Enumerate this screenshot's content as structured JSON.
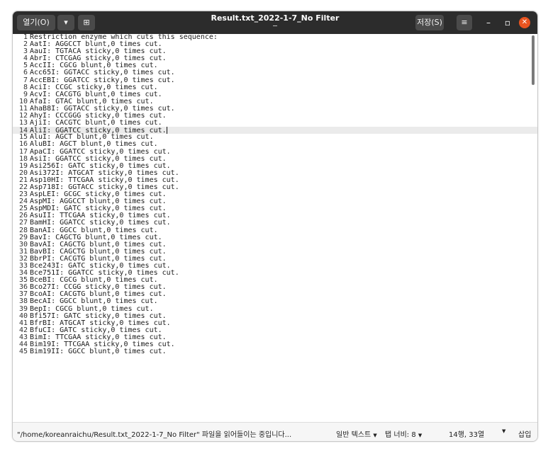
{
  "titlebar": {
    "open_label": "열기(O)",
    "title": "Result.txt_2022-1-7_No Filter",
    "save_label": "저장(S)"
  },
  "editor": {
    "current_line": 14,
    "lines": [
      "Restriction enzyme which cuts this sequence:",
      "AatI: AGGCCT blunt,0 times cut.",
      "AauI: TGTACA sticky,0 times cut.",
      "AbrI: CTCGAG sticky,0 times cut.",
      "AccII: CGCG blunt,0 times cut.",
      "Acc65I: GGTACC sticky,0 times cut.",
      "AccEBI: GGATCC sticky,0 times cut.",
      "AciI: CCGC sticky,0 times cut.",
      "AcvI: CACGTG blunt,0 times cut.",
      "AfaI: GTAC blunt,0 times cut.",
      "AhaB8I: GGTACC sticky,0 times cut.",
      "AhyI: CCCGGG sticky,0 times cut.",
      "AjiI: CACGTC blunt,0 times cut.",
      "AliI: GGATCC sticky,0 times cut.",
      "AluI: AGCT blunt,0 times cut.",
      "AluBI: AGCT blunt,0 times cut.",
      "ApaCI: GGATCC sticky,0 times cut.",
      "AsiI: GGATCC sticky,0 times cut.",
      "Asi256I: GATC sticky,0 times cut.",
      "Asi372I: ATGCAT sticky,0 times cut.",
      "Asp10HI: TTCGAA sticky,0 times cut.",
      "Asp718I: GGTACC sticky,0 times cut.",
      "AspLEI: GCGC sticky,0 times cut.",
      "AspMI: AGGCCT blunt,0 times cut.",
      "AspMDI: GATC sticky,0 times cut.",
      "AsuII: TTCGAA sticky,0 times cut.",
      "BamHI: GGATCC sticky,0 times cut.",
      "BanAI: GGCC blunt,0 times cut.",
      "BavI: CAGCTG blunt,0 times cut.",
      "BavAI: CAGCTG blunt,0 times cut.",
      "BavBI: CAGCTG blunt,0 times cut.",
      "BbrPI: CACGTG blunt,0 times cut.",
      "Bce243I: GATC sticky,0 times cut.",
      "Bce751I: GGATCC sticky,0 times cut.",
      "BceBI: CGCG blunt,0 times cut.",
      "Bco27I: CCGG sticky,0 times cut.",
      "BcoAI: CACGTG blunt,0 times cut.",
      "BecAI: GGCC blunt,0 times cut.",
      "BepI: CGCG blunt,0 times cut.",
      "Bfi57I: GATC sticky,0 times cut.",
      "BfrBI: ATGCAT sticky,0 times cut.",
      "BfuCI: GATC sticky,0 times cut.",
      "BimI: TTCGAA sticky,0 times cut.",
      "Bim19I: TTCGAA sticky,0 times cut.",
      "Bim19II: GGCC blunt,0 times cut."
    ]
  },
  "statusbar": {
    "message": "\"/home/koreanraichu/Result.txt_2022-1-7_No Filter\" 파일을 읽어들이는 중입니다...",
    "syntax": "일반 텍스트",
    "tab_width": "탭 너비: 8",
    "position": "14행, 33열",
    "insert_mode": "삽입"
  }
}
